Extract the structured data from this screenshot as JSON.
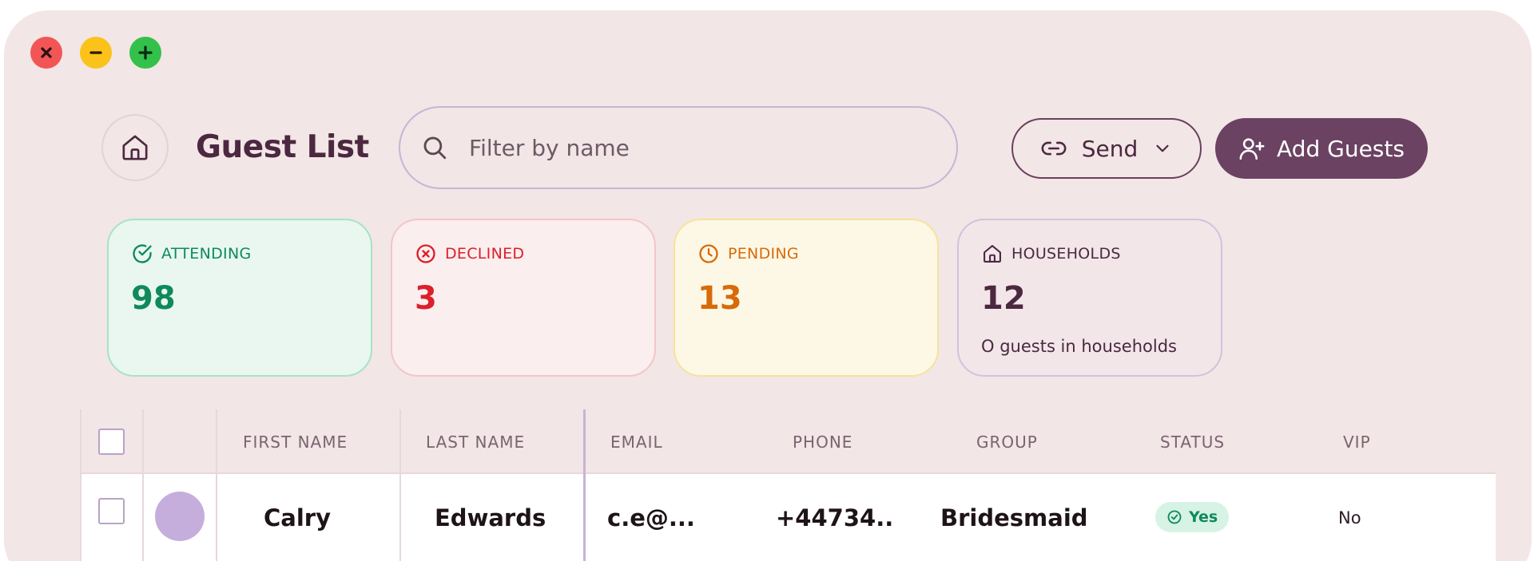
{
  "window_controls": {
    "close_glyph": "X",
    "colors": {
      "close": "#f25556",
      "minimize": "#fbc21a",
      "maximize": "#33c14b"
    }
  },
  "header": {
    "home_icon": "home-icon",
    "title": "Guest List",
    "search": {
      "placeholder": "Filter by name",
      "value": "",
      "icon": "search-icon"
    },
    "send_button": {
      "label": "Send",
      "icon": "link-icon",
      "dropdown_icon": "chevron-down-icon"
    },
    "add_button": {
      "label": "Add Guests",
      "icon": "user-plus-icon"
    }
  },
  "stats": {
    "attending": {
      "label": "ATTENDING",
      "value": "98",
      "icon": "check-circle-icon",
      "color": "#0e8a5c"
    },
    "declined": {
      "label": "DECLINED",
      "value": "3",
      "icon": "x-circle-icon",
      "color": "#dc1f2a"
    },
    "pending": {
      "label": "PENDING",
      "value": "13",
      "icon": "clock-icon",
      "color": "#d76b0b"
    },
    "households": {
      "label": "HOUSEHOLDS",
      "value": "12",
      "sub": "O guests in households",
      "icon": "home-icon",
      "color": "#4b2840"
    }
  },
  "table": {
    "columns": [
      "FIRST NAME",
      "LAST NAME",
      "EMAIL",
      "PHONE",
      "GROUP",
      "STATUS",
      "VIP"
    ],
    "rows": [
      {
        "first_name": "Calry",
        "last_name": "Edwards",
        "email": "c.e@...",
        "phone": "+44734..",
        "group": "Bridesmaid",
        "status": "Yes",
        "vip": "No"
      }
    ]
  },
  "colors": {
    "window_bg": "#f2e6e6",
    "accent": "#6b4262",
    "title": "#4b2840"
  }
}
